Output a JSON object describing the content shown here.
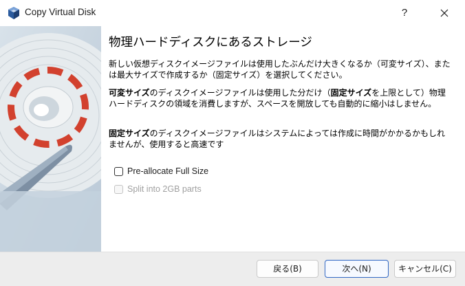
{
  "window": {
    "title": "Copy Virtual Disk",
    "help_label": "?"
  },
  "page": {
    "heading": "物理ハードディスクにあるストレージ",
    "p1": "新しい仮想ディスクイメージファイルは使用したぶんだけ大きくなるか（可変サイズ）、または最大サイズで作成するか（固定サイズ）を選択してください。",
    "p2_bold1": "可変サイズ",
    "p2_text1": "のディスクイメージファイルは使用した分だけ（",
    "p2_bold2": "固定サイズ",
    "p2_text2": "を上限として）物理ハードディスクの領域を消費しますが、スペースを開放しても自動的に縮小はしません。",
    "p3_bold": "固定サイズ",
    "p3_text": "のディスクイメージファイルはシステムによっては作成に時間がかかるかもしれませんが、使用すると高速です"
  },
  "options": {
    "preallocate": {
      "label": "Pre-allocate Full Size",
      "checked": false,
      "enabled": true
    },
    "split": {
      "label": "Split into 2GB parts",
      "checked": false,
      "enabled": false
    }
  },
  "footer": {
    "back_label": "戻る(B)",
    "next_label": "次へ(N)",
    "cancel_label": "キャンセル(C)"
  },
  "colors": {
    "accent": "#2f66c4",
    "panel_bg": "#c8d5e0",
    "disk_red": "#d2412e"
  },
  "icons": {
    "app": "virtualbox-cube-icon",
    "close": "close-icon",
    "side_art": "hard-disk-illustration"
  }
}
